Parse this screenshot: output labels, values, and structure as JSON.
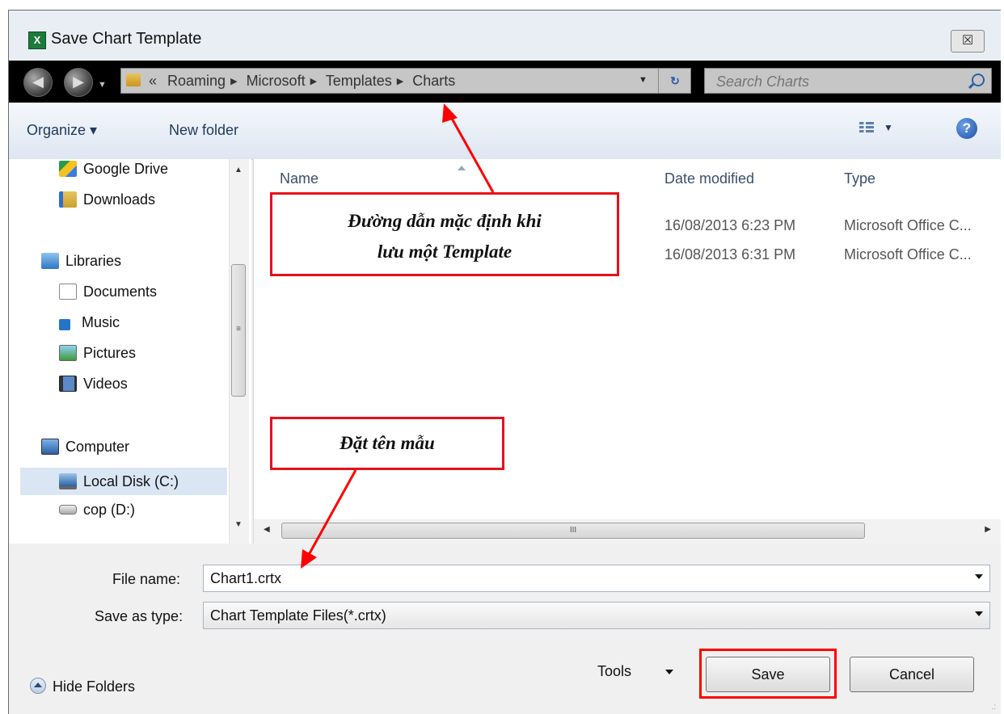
{
  "window": {
    "title": "Save Chart Template",
    "app_icon": "excel-icon",
    "close_glyph": "☒"
  },
  "nav": {
    "breadcrumb": [
      "«",
      "Roaming",
      "Microsoft",
      "Templates",
      "Charts"
    ],
    "search_placeholder": "Search Charts"
  },
  "toolbar": {
    "organize_label": "Organize ▾",
    "new_folder_label": "New folder"
  },
  "sidebar": {
    "items": [
      {
        "label": "Google Drive",
        "icon": "google-drive-icon"
      },
      {
        "label": "Downloads",
        "icon": "downloads-folder-icon"
      },
      {
        "label": "Libraries",
        "icon": "libraries-icon"
      },
      {
        "label": "Documents",
        "icon": "documents-icon"
      },
      {
        "label": "Music",
        "icon": "music-icon"
      },
      {
        "label": "Pictures",
        "icon": "pictures-icon"
      },
      {
        "label": "Videos",
        "icon": "videos-icon"
      },
      {
        "label": "Computer",
        "icon": "computer-icon"
      },
      {
        "label": "Local Disk (C:)",
        "icon": "local-disk-icon",
        "selected": true
      },
      {
        "label": "cop (D:)",
        "icon": "drive-icon"
      }
    ]
  },
  "files": {
    "columns": [
      "Name",
      "Date modified",
      "Type"
    ],
    "rows": [
      {
        "date": "16/08/2013 6:23 PM",
        "type": "Microsoft Office C..."
      },
      {
        "date": "16/08/2013 6:31 PM",
        "type": "Microsoft Office C..."
      }
    ]
  },
  "form": {
    "file_name_label": "File name:",
    "file_name_value": "Chart1.crtx",
    "save_type_label": "Save as type:",
    "save_type_value": "Chart Template Files(*.crtx)"
  },
  "footer": {
    "hide_folders_label": "Hide Folders",
    "tools_label": "Tools",
    "save_label": "Save",
    "cancel_label": "Cancel"
  },
  "annotations": {
    "path_note_line1": "Đường dẫn mặc định khi",
    "path_note_line2": "lưu một Template",
    "name_note": "Đặt tên mẫu",
    "color": "#ff0000"
  }
}
